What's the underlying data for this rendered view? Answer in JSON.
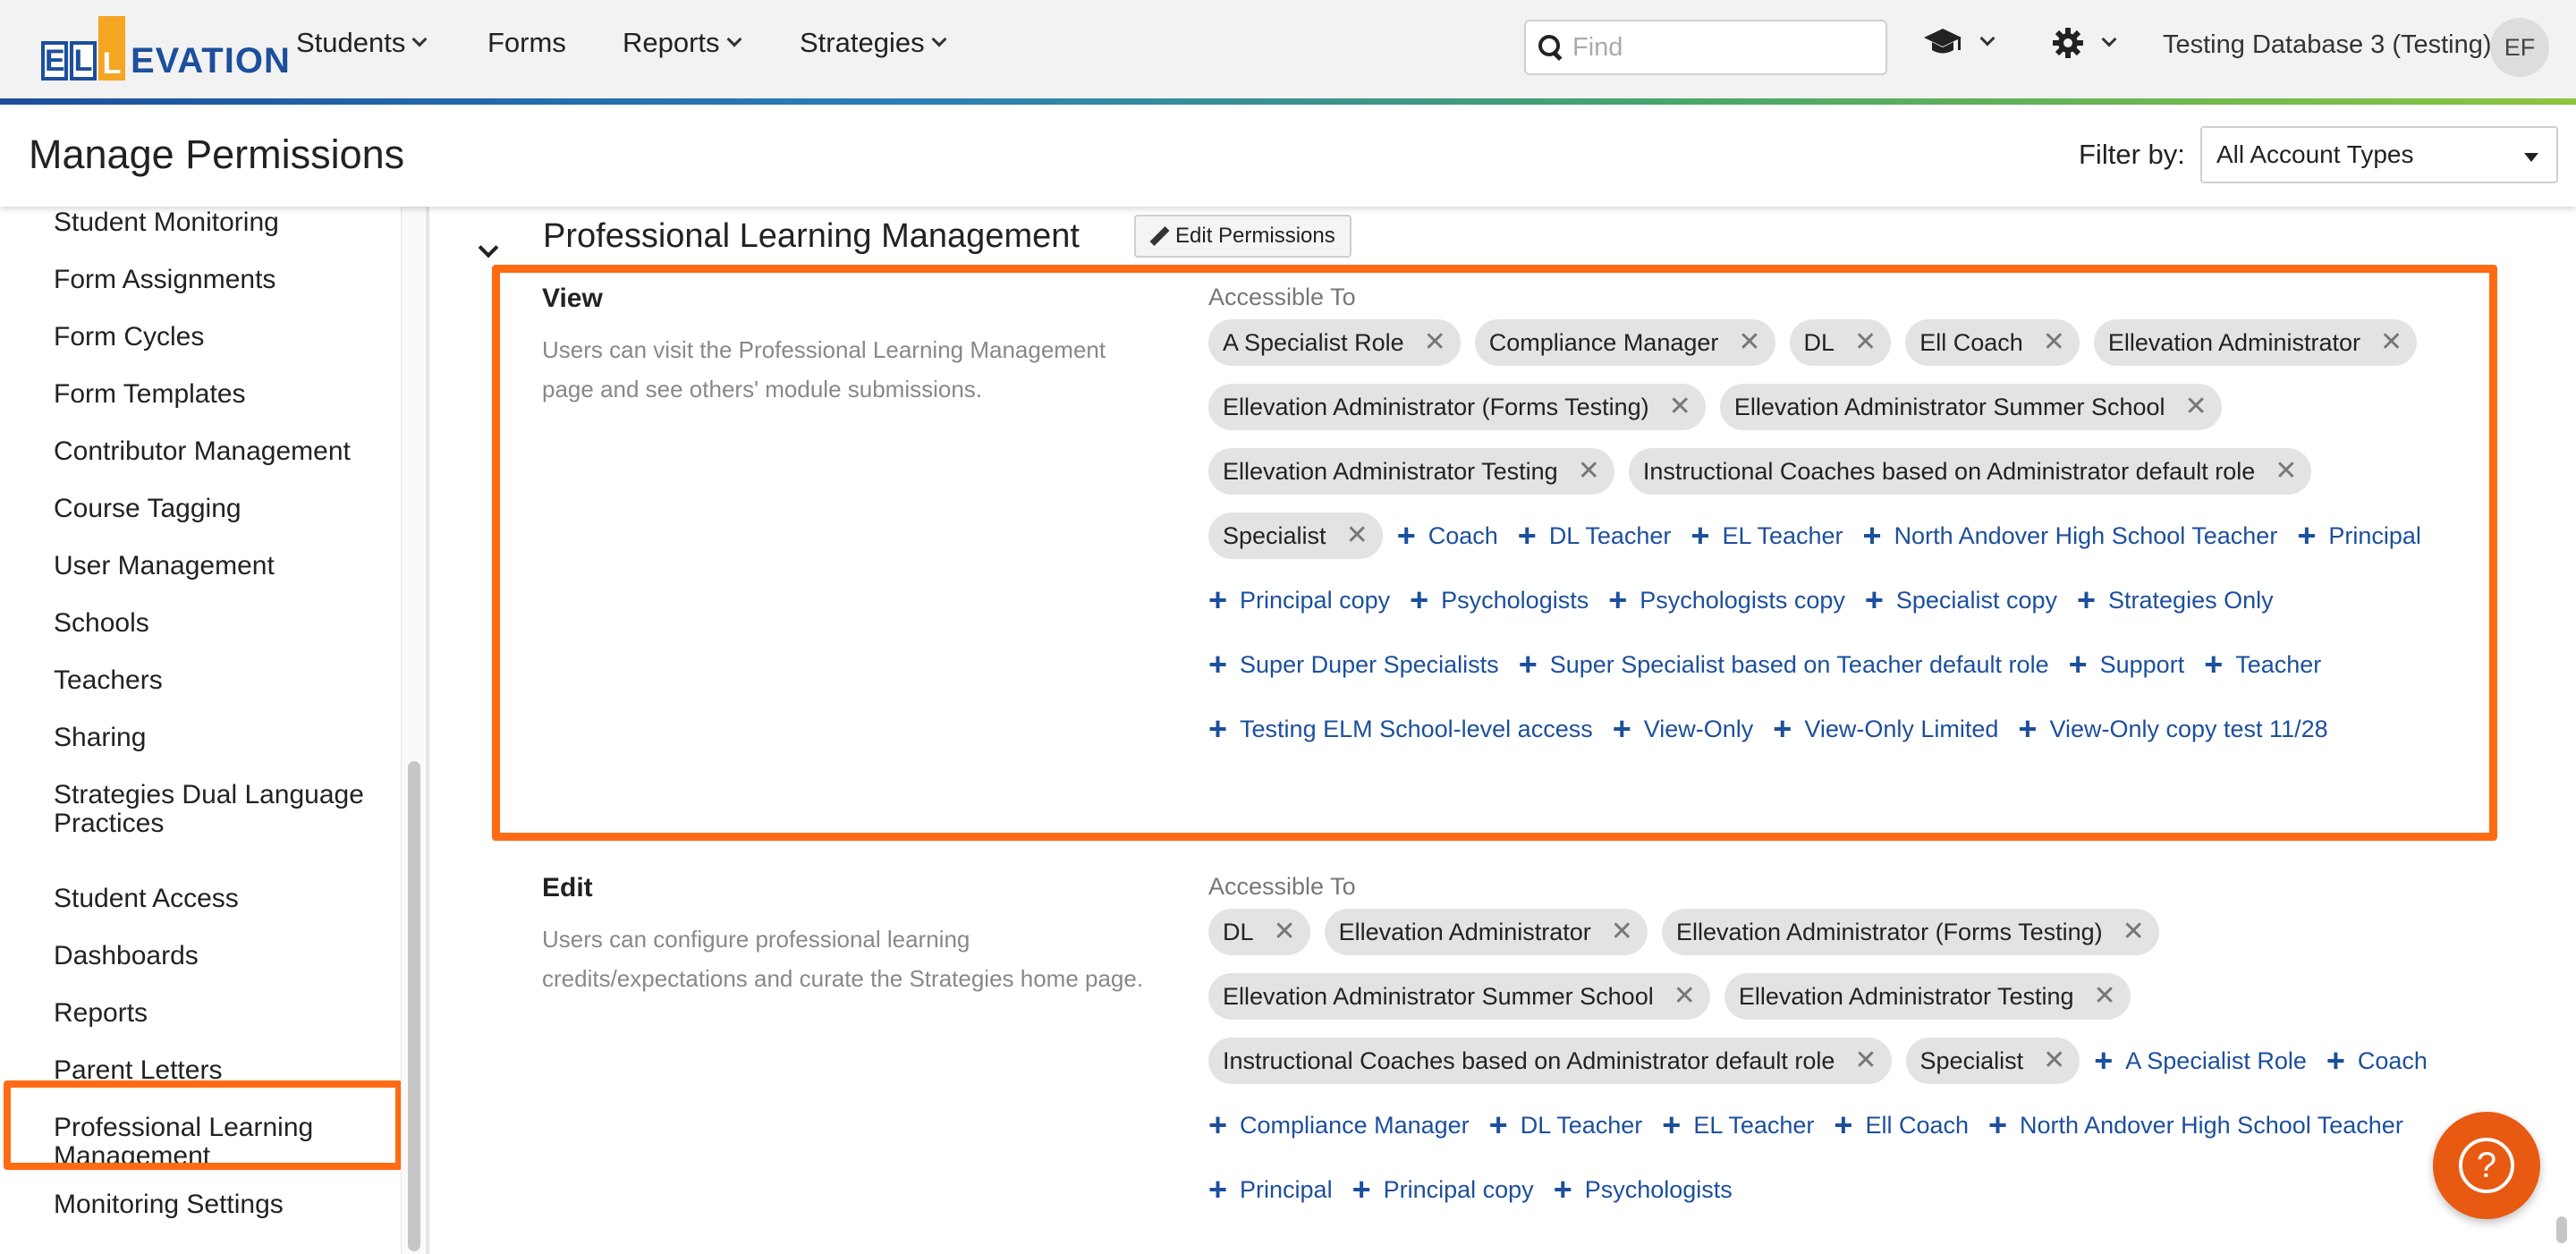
{
  "app": {
    "logo_letters": [
      "E",
      "L",
      "L"
    ],
    "logo_text": "EVATION",
    "nav": [
      {
        "label": "Students",
        "has_dropdown": true
      },
      {
        "label": "Forms",
        "has_dropdown": false
      },
      {
        "label": "Reports",
        "has_dropdown": true
      },
      {
        "label": "Strategies",
        "has_dropdown": true
      }
    ],
    "search_placeholder": "Find",
    "database": "Testing Database 3 (Testing)",
    "avatar_initials": "EF",
    "icons": {
      "graduation": "graduation-cap-icon",
      "settings": "gear-icon"
    }
  },
  "header": {
    "title": "Manage Permissions",
    "filter_label": "Filter by:",
    "filter_value": "All Account Types"
  },
  "sidebar": {
    "items": [
      "Student Monitoring",
      "Form Assignments",
      "Form Cycles",
      "Form Templates",
      "Contributor Management",
      "Course Tagging",
      "User Management",
      "Schools",
      "Teachers",
      "Sharing",
      "Strategies Dual Language Practices",
      "Student Access",
      "Dashboards",
      "Reports",
      "Parent Letters",
      "Professional Learning Management",
      "Monitoring Settings"
    ],
    "selected": "Professional Learning Management"
  },
  "section": {
    "title": "Professional Learning Management",
    "edit_button": "Edit Permissions",
    "permissions": [
      {
        "title": "View",
        "description": "Users can visit the Professional Learning Management page and see others' module submissions.",
        "accessible_label": "Accessible To",
        "granted": [
          "A Specialist Role",
          "Compliance Manager",
          "DL",
          "Ell Coach",
          "Ellevation Administrator",
          "Ellevation Administrator (Forms Testing)",
          "Ellevation Administrator Summer School",
          "Ellevation Administrator Testing",
          "Instructional Coaches based on Administrator default role",
          "Specialist"
        ],
        "available": [
          "Coach",
          "DL Teacher",
          "EL Teacher",
          "North Andover High School Teacher",
          "Principal",
          "Principal copy",
          "Psychologists",
          "Psychologists copy",
          "Specialist copy",
          "Strategies Only",
          "Super Duper Specialists",
          "Super Specialist based on Teacher default role",
          "Support",
          "Teacher",
          "Testing ELM School-level access",
          "View-Only",
          "View-Only Limited",
          "View-Only copy test 11/28"
        ]
      },
      {
        "title": "Edit",
        "description": "Users can configure professional learning credits/expectations and curate the Strategies home page.",
        "accessible_label": "Accessible To",
        "granted": [
          "DL",
          "Ellevation Administrator",
          "Ellevation Administrator (Forms Testing)",
          "Ellevation Administrator Summer School",
          "Ellevation Administrator Testing",
          "Instructional Coaches based on Administrator default role",
          "Specialist"
        ],
        "available": [
          "A Specialist Role",
          "Coach",
          "Compliance Manager",
          "DL Teacher",
          "EL Teacher",
          "Ell Coach",
          "North Andover High School Teacher",
          "Principal",
          "Principal copy",
          "Psychologists"
        ]
      }
    ]
  },
  "help": {
    "glyph": "?"
  },
  "colors": {
    "brand_blue": "#1c4f9c",
    "highlight_orange": "#ff6a13",
    "help_orange": "#e85a12",
    "link_blue": "#1c4f9c"
  }
}
